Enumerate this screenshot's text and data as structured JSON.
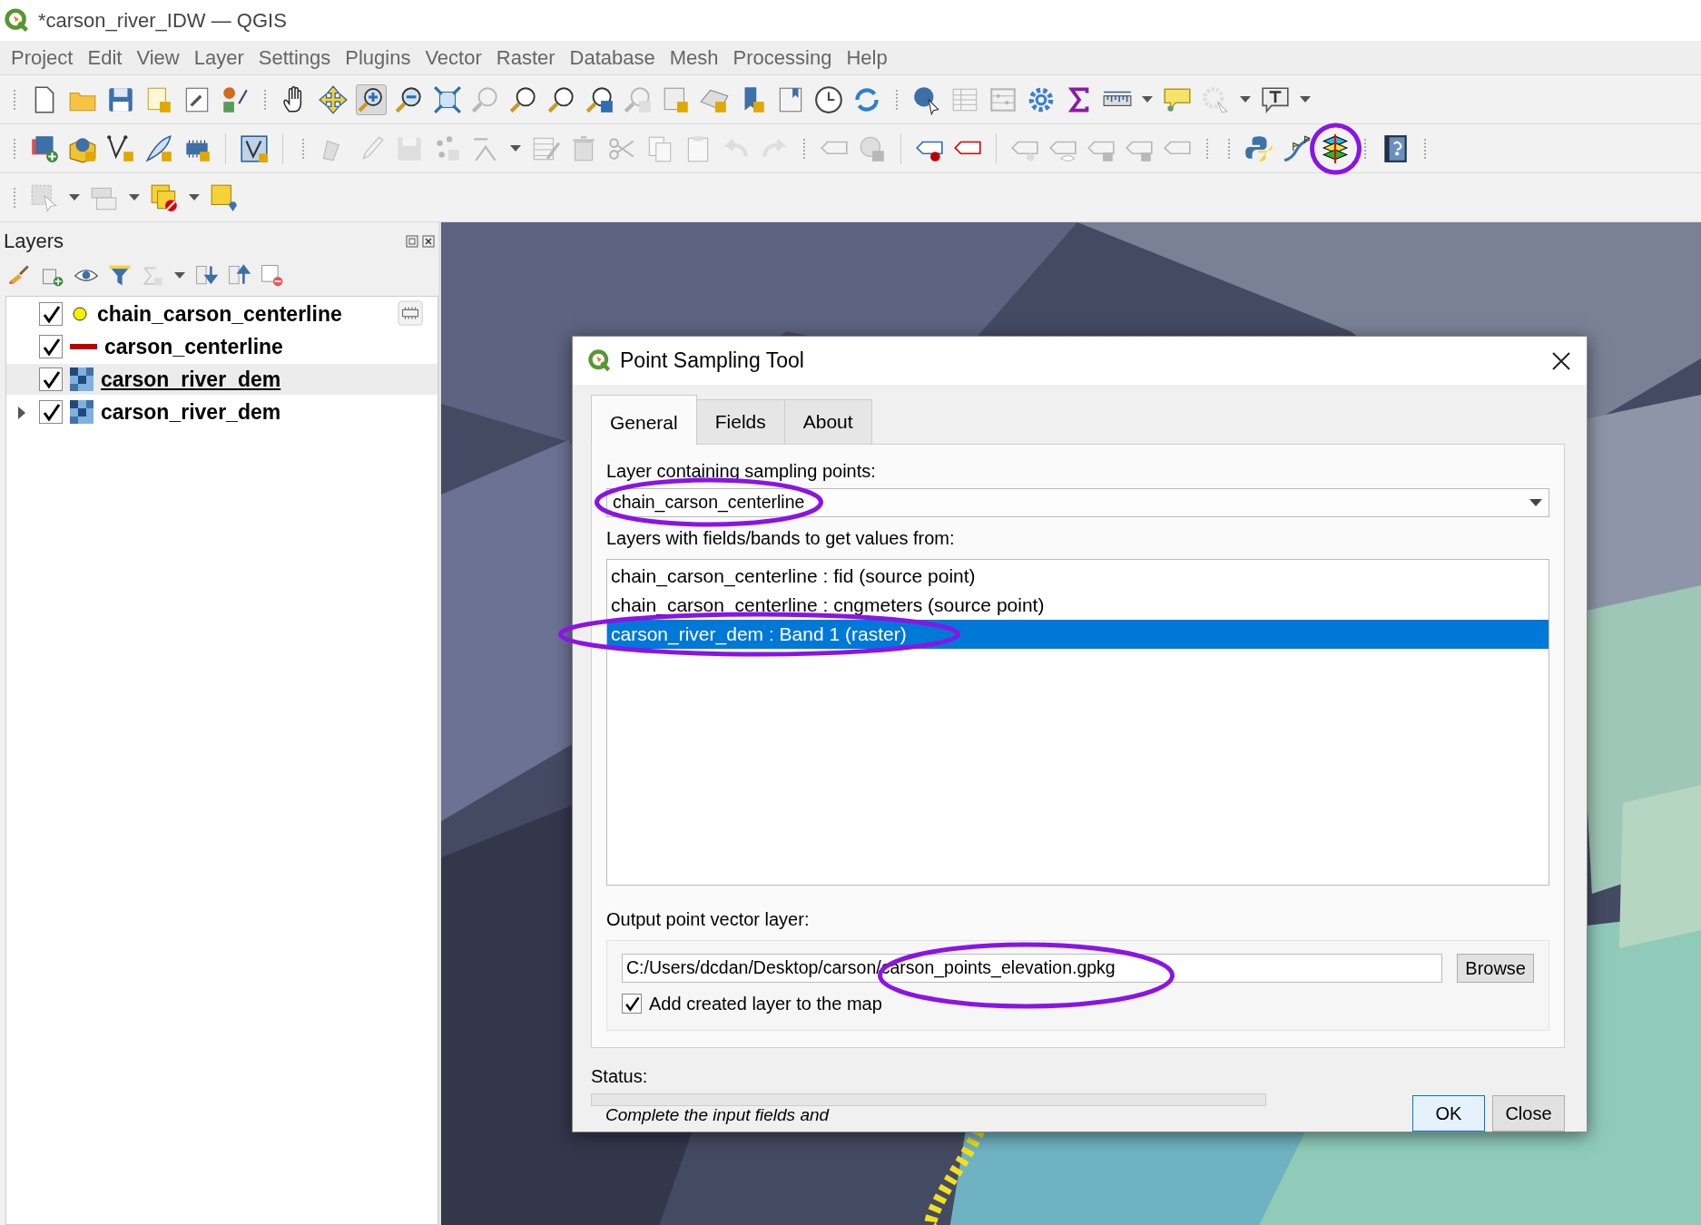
{
  "window": {
    "title": "*carson_river_IDW — QGIS"
  },
  "menu": [
    {
      "label": "Project"
    },
    {
      "label": "Edit"
    },
    {
      "label": "View"
    },
    {
      "label": "Layer"
    },
    {
      "label": "Settings"
    },
    {
      "label": "Plugins"
    },
    {
      "label": "Vector"
    },
    {
      "label": "Raster"
    },
    {
      "label": "Database"
    },
    {
      "label": "Mesh"
    },
    {
      "label": "Processing"
    },
    {
      "label": "Help"
    }
  ],
  "layers_panel": {
    "title": "Layers",
    "layers": [
      {
        "name": "chain_carson_centerline",
        "checked": true,
        "selected": false,
        "kind": "point"
      },
      {
        "name": "carson_centerline",
        "checked": true,
        "selected": false,
        "kind": "line"
      },
      {
        "name": "carson_river_dem",
        "checked": true,
        "selected": true,
        "kind": "raster"
      },
      {
        "name": "carson_river_dem",
        "checked": true,
        "selected": false,
        "kind": "raster",
        "expanded": false
      }
    ]
  },
  "dialog": {
    "title": "Point Sampling Tool",
    "tabs": [
      {
        "label": "General",
        "selected": true
      },
      {
        "label": "Fields",
        "selected": false
      },
      {
        "label": "About",
        "selected": false
      }
    ],
    "points_layer": {
      "label": "Layer containing sampling points:",
      "value": "chain_carson_centerline"
    },
    "sources": {
      "label": "Layers with fields/bands to get values from:",
      "items": [
        {
          "text": "chain_carson_centerline : fid (source point)",
          "selected": false
        },
        {
          "text": "chain_carson_centerline : cngmeters (source point)",
          "selected": false
        },
        {
          "text": "carson_river_dem : Band 1 (raster)",
          "selected": true
        }
      ]
    },
    "output": {
      "label": "Output point vector layer:",
      "value": "C:/Users/dcdan/Desktop/carson/carson_points_elevation.gpkg",
      "browse": "Browse",
      "add_to_map": {
        "label": "Add created layer to the map",
        "checked": true
      }
    },
    "status": {
      "label": "Status:",
      "text": "Complete the input fields and"
    },
    "buttons": [
      "OK",
      "Close"
    ]
  }
}
